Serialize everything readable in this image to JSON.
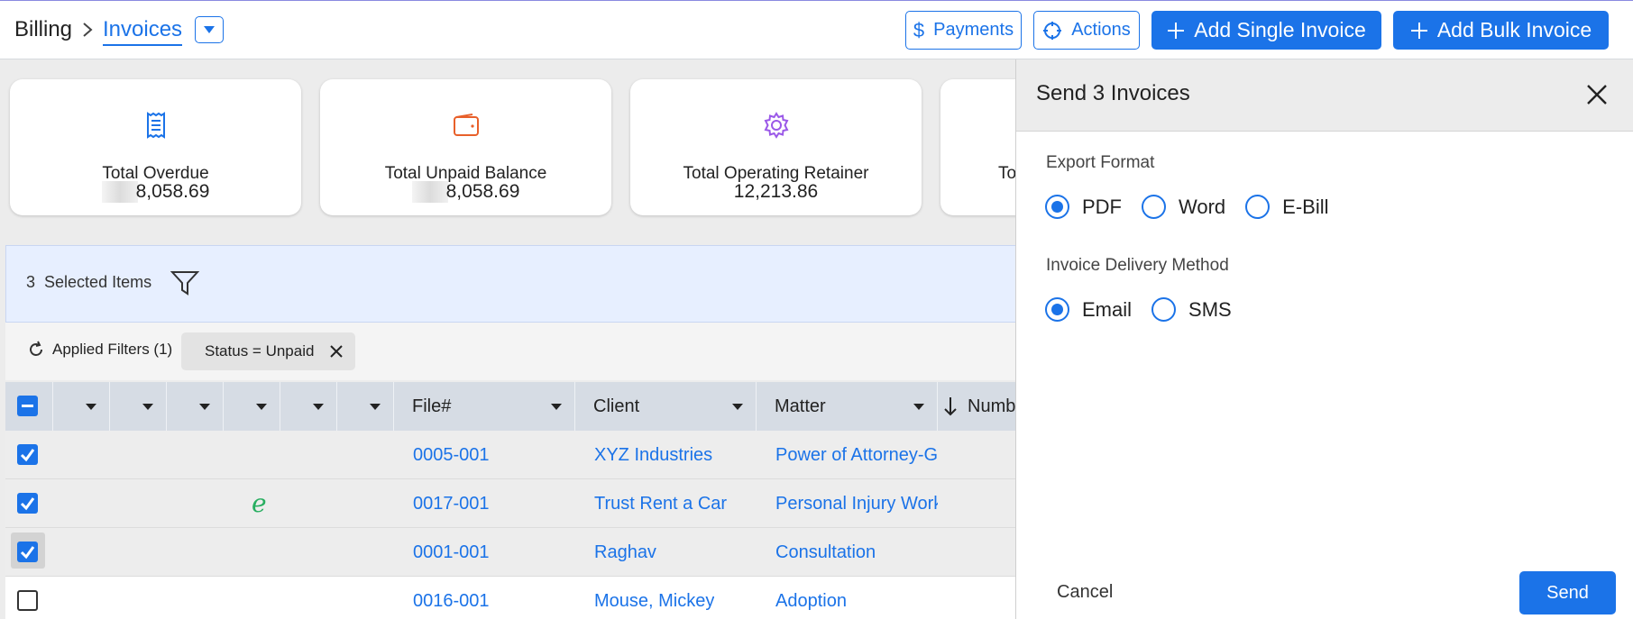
{
  "breadcrumb": {
    "root": "Billing",
    "current": "Invoices"
  },
  "header_buttons": {
    "payments": "Payments",
    "actions": "Actions",
    "add_single": "Add Single Invoice",
    "add_bulk": "Add Bulk Invoice"
  },
  "cards": [
    {
      "label": "Total Overdue",
      "value": "8,058.69",
      "icon": "receipt-icon",
      "icon_color": "#1b73e8"
    },
    {
      "label": "Total Unpaid Balance",
      "value": "8,058.69",
      "icon": "wallet-icon",
      "icon_color": "#e8602a"
    },
    {
      "label": "Total Operating Retainer",
      "value": "12,213.86",
      "icon": "gear-icon",
      "icon_color": "#9b59e8"
    },
    {
      "label": "To",
      "value": ""
    }
  ],
  "selection": {
    "count": "3",
    "label": "Selected Items"
  },
  "filters": {
    "applied_label": "Applied Filters (1)",
    "chip": "Status = Unpaid"
  },
  "table": {
    "columns": [
      "File#",
      "Client",
      "Matter",
      "Numb"
    ],
    "rows": [
      {
        "checked": true,
        "file": "0005-001",
        "client": "XYZ Industries",
        "matter": "Power of Attorney-G",
        "ebill": ""
      },
      {
        "checked": true,
        "file": "0017-001",
        "client": "Trust Rent a Car",
        "matter": "Personal Injury Work",
        "ebill": "e"
      },
      {
        "checked": true,
        "file": "0001-001",
        "client": "Raghav",
        "matter": "Consultation",
        "ebill": ""
      },
      {
        "checked": false,
        "file": "0016-001",
        "client": "Mouse, Mickey",
        "matter": "Adoption",
        "ebill": ""
      }
    ]
  },
  "panel": {
    "title": "Send 3 Invoices",
    "export_label": "Export Format",
    "export_options": [
      "PDF",
      "Word",
      "E-Bill"
    ],
    "export_selected": "PDF",
    "delivery_label": "Invoice Delivery Method",
    "delivery_options": [
      "Email",
      "SMS"
    ],
    "delivery_selected": "Email",
    "cancel": "Cancel",
    "send": "Send"
  },
  "colors": {
    "accent": "#1b73e8",
    "ebill": "#27ae60"
  }
}
